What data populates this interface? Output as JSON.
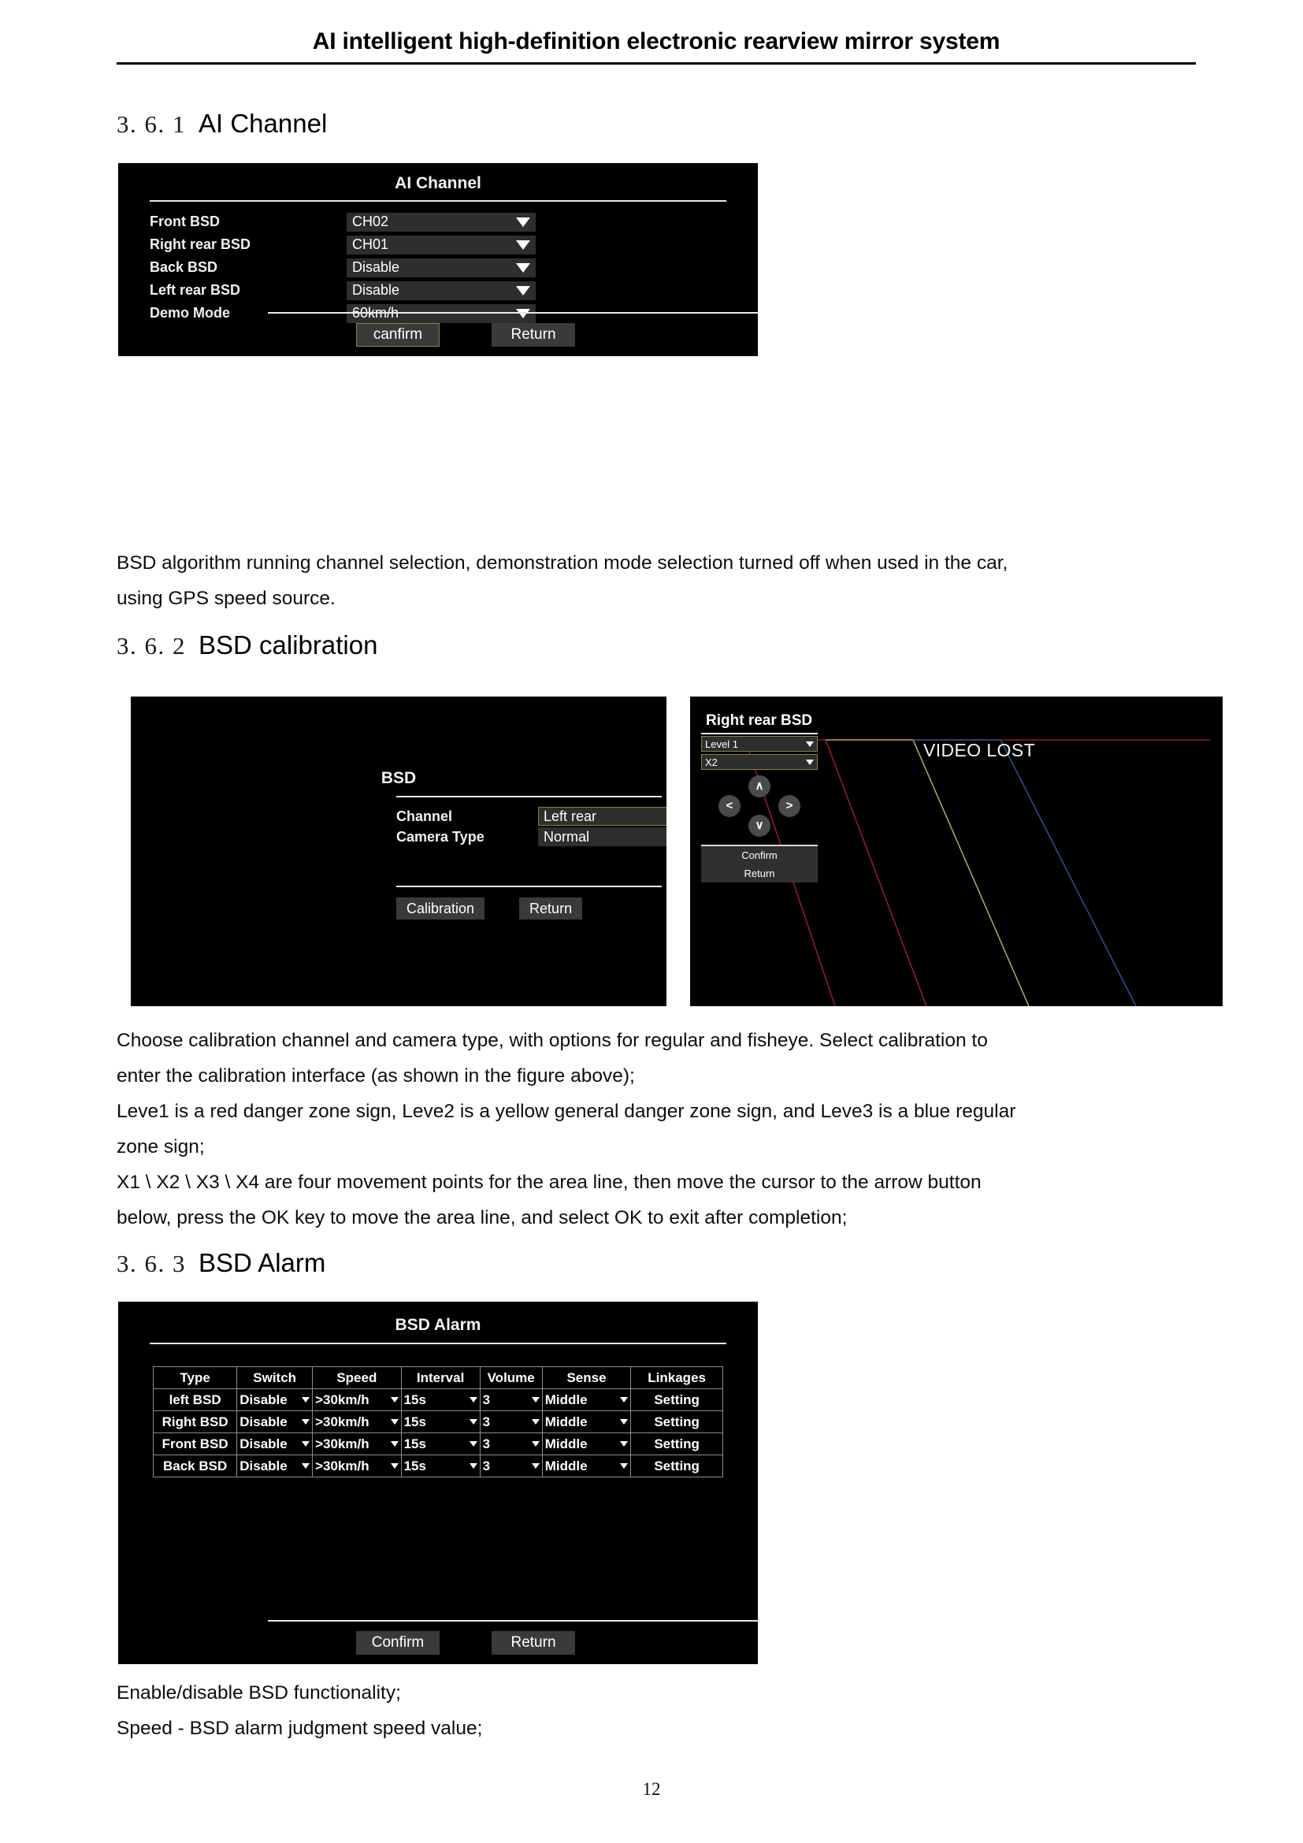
{
  "header": {
    "title": "AI intelligent high-definition electronic rearview mirror system"
  },
  "sections": {
    "ai_channel": {
      "number": "3. 6. 1",
      "name": "AI Channel"
    },
    "bsd_calibration": {
      "number": "3. 6. 2",
      "name": "BSD calibration"
    },
    "bsd_alarm": {
      "number": "3. 6. 3",
      "name": "BSD Alarm"
    }
  },
  "paragraphs": {
    "ai_channel": [
      "BSD algorithm running channel selection, demonstration mode selection turned off when used in the car,",
      "using GPS speed source."
    ],
    "bsd_calibration": [
      "Choose calibration channel and camera type, with options for regular and fisheye. Select calibration to",
      "enter the calibration interface (as shown in the figure above);",
      "Leve1 is a red danger zone sign, Leve2 is a yellow general danger zone sign, and Leve3 is a blue regular",
      "zone sign;",
      "X1 \\ X2 \\ X3 \\ X4 are four movement points for the area line, then move the cursor to the arrow button",
      "below, press the OK key to move the area line, and select OK to exit after completion;"
    ],
    "bsd_alarm": [
      "Enable/disable BSD functionality;",
      "Speed - BSD alarm judgment speed value;"
    ]
  },
  "ai_channel_panel": {
    "title": "AI  Channel",
    "rows": [
      {
        "label": "Front  BSD",
        "value": "CH02"
      },
      {
        "label": "Right rear BSD",
        "value": "CH01"
      },
      {
        "label": "Back  BSD",
        "value": "Disable"
      },
      {
        "label": "Left rear BSD",
        "value": "Disable"
      },
      {
        "label": "Demo Mode",
        "value": "60km/h"
      }
    ],
    "buttons": {
      "confirm": "canfirm",
      "return": "Return"
    }
  },
  "bsd_panel": {
    "title": "BSD",
    "rows": [
      {
        "label": "Channel",
        "value": "Left rear"
      },
      {
        "label": "Camera Type",
        "value": "Normal"
      }
    ],
    "buttons": {
      "calibration": "Calibration",
      "return": "Return"
    }
  },
  "calibration_panel": {
    "title": "Right rear BSD",
    "level_value": "Level 1",
    "point_value": "X2",
    "dpad": {
      "up": "∧",
      "down": "∨",
      "left": "<",
      "right": ">"
    },
    "buttons": {
      "confirm": "Confirm",
      "return": "Return"
    },
    "video_status": "VIDEO LOST",
    "zone_colors": {
      "level1": "#8e1b2c",
      "level2": "#a9a15a",
      "level3": "#2e4c8a"
    }
  },
  "bsd_alarm_panel": {
    "title": "BSD Alarm",
    "columns": [
      "Type",
      "Switch",
      "Speed",
      "Interval",
      "Volume",
      "Sense",
      "Linkages"
    ],
    "rows": [
      {
        "type": "left BSD",
        "switch": "Disable",
        "speed": ">30km/h",
        "interval": "15s",
        "volume": "3",
        "sense": "Middle",
        "linkages": "Setting"
      },
      {
        "type": "Right BSD",
        "switch": "Disable",
        "speed": ">30km/h",
        "interval": "15s",
        "volume": "3",
        "sense": "Middle",
        "linkages": "Setting"
      },
      {
        "type": "Front BSD",
        "switch": "Disable",
        "speed": ">30km/h",
        "interval": "15s",
        "volume": "3",
        "sense": "Middle",
        "linkages": "Setting"
      },
      {
        "type": "Back BSD",
        "switch": "Disable",
        "speed": ">30km/h",
        "interval": "15s",
        "volume": "3",
        "sense": "Middle",
        "linkages": "Setting"
      }
    ],
    "buttons": {
      "confirm": "Confirm",
      "return": "Return"
    }
  },
  "footer": {
    "page_number": "12"
  }
}
